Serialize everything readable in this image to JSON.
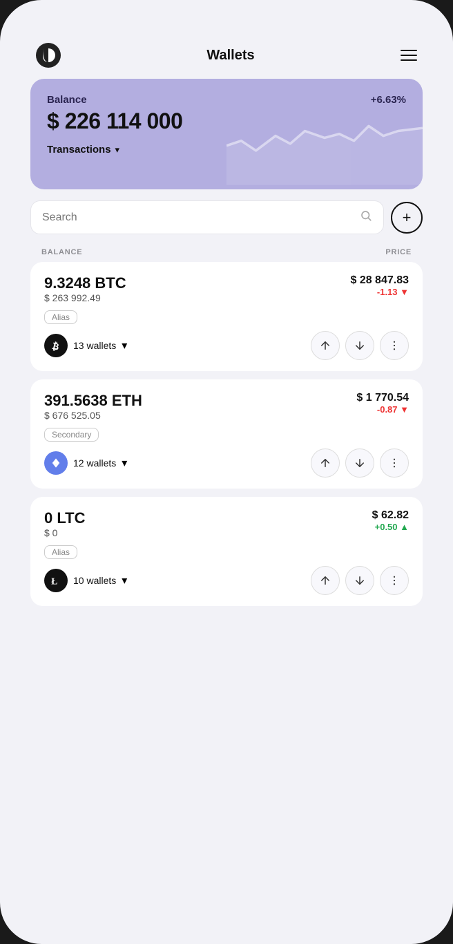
{
  "header": {
    "title": "Wallets",
    "logo": "D",
    "menu_label": "menu"
  },
  "balance_card": {
    "label": "Balance",
    "percent": "+6.63%",
    "amount": "$ 226 114 000",
    "transactions_label": "Transactions"
  },
  "search": {
    "placeholder": "Search"
  },
  "columns": {
    "balance": "BALANCE",
    "price": "PRICE"
  },
  "add_button_label": "+",
  "crypto_list": [
    {
      "id": "btc",
      "amount": "9.3248 BTC",
      "value": "$ 263 992.49",
      "price": "$ 28 847.83",
      "change": "-1.13 ▼",
      "change_type": "negative",
      "alias": "Alias",
      "wallets": "13 wallets",
      "symbol": "₿"
    },
    {
      "id": "eth",
      "amount": "391.5638 ETH",
      "value": "$ 676 525.05",
      "price": "$ 1 770.54",
      "change": "-0.87 ▼",
      "change_type": "negative",
      "alias": "Secondary",
      "wallets": "12 wallets",
      "symbol": "Ξ"
    },
    {
      "id": "ltc",
      "amount": "0 LTC",
      "value": "$ 0",
      "price": "$ 62.82",
      "change": "+0.50 ▲",
      "change_type": "positive",
      "alias": "Alias",
      "wallets": "10 wallets",
      "symbol": "Ł"
    }
  ]
}
